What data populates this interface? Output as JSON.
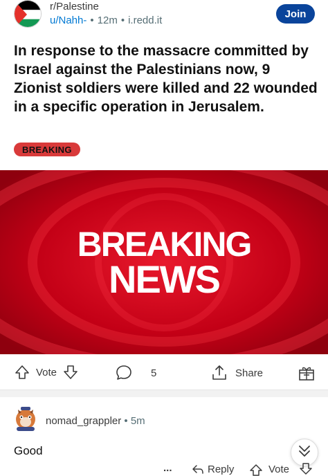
{
  "header": {
    "subreddit": "r/Palestine",
    "user": "u/Nahh-",
    "age": "12m",
    "domain": "i.redd.it",
    "join_label": "Join"
  },
  "post": {
    "title": "In response to the massacre committed by Israel against the Palestinians now, 9 Zionist soldiers were killed and 22 wounded in a specific operation in Jerusalem.",
    "flair": "BREAKING",
    "image_text_line1": "BREAKING",
    "image_text_line2": "NEWS"
  },
  "actions": {
    "vote_label": "Vote",
    "comment_count": "5",
    "share_label": "Share"
  },
  "comment": {
    "author": "nomad_grappler",
    "age": "5m",
    "body": "Good",
    "more": "...",
    "reply_label": "Reply",
    "vote_label": "Vote"
  },
  "colors": {
    "join_bg": "#0a449b",
    "flair_bg": "#d93a3a",
    "image_red": "#b80012",
    "user_link": "#0079d3"
  }
}
